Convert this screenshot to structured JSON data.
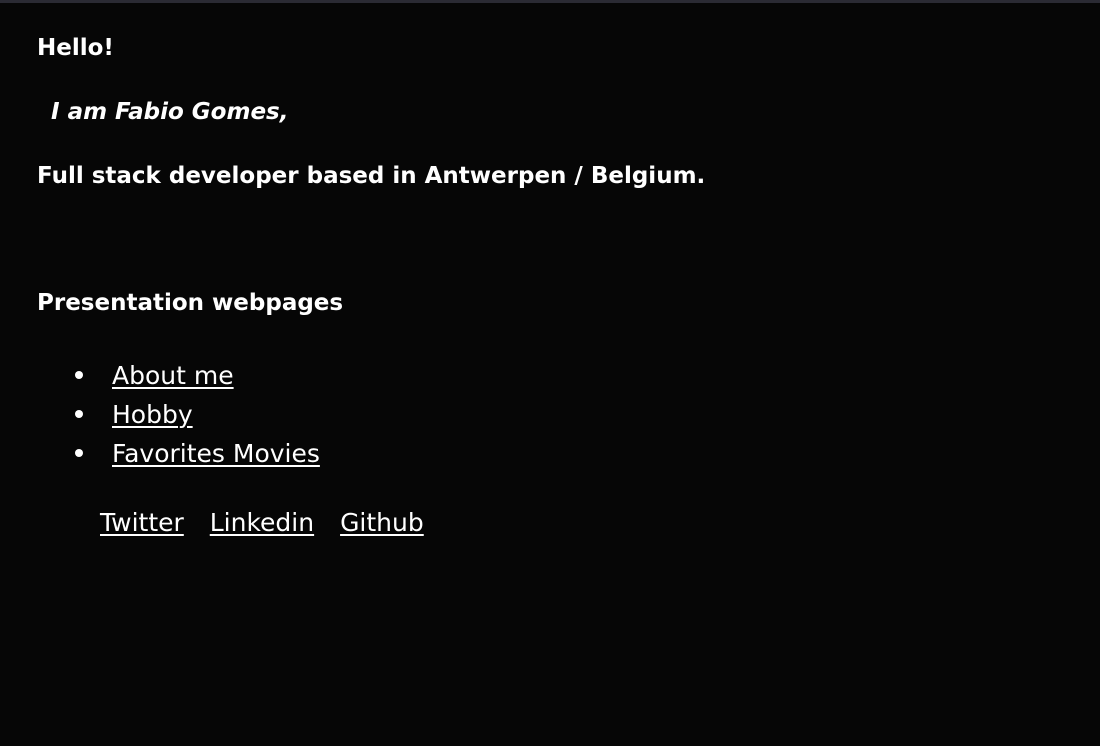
{
  "header": {
    "greeting": "Hello!",
    "intro": "I am Fabio Gomes,",
    "tagline": "Full stack developer based in Antwerpen / Belgium."
  },
  "presentation": {
    "title": "Presentation webpages",
    "links": [
      {
        "label": "About me"
      },
      {
        "label": "Hobby"
      },
      {
        "label": "Favorites Movies"
      }
    ]
  },
  "social": {
    "links": [
      {
        "label": "Twitter"
      },
      {
        "label": "Linkedin"
      },
      {
        "label": "Github"
      }
    ]
  },
  "colors": {
    "background": "#060606",
    "text": "#ffffff"
  }
}
